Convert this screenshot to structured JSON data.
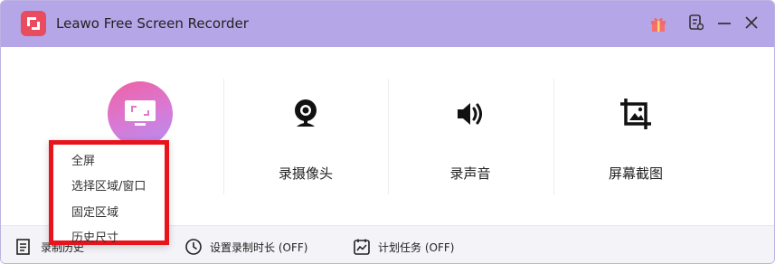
{
  "window": {
    "title": "Leawo Free Screen Recorder"
  },
  "modes": [
    {
      "label": "",
      "icon": "monitor-icon",
      "active": true
    },
    {
      "label": "录摄像头",
      "icon": "webcam-icon"
    },
    {
      "label": "录声音",
      "icon": "speaker-icon"
    },
    {
      "label": "屏幕截图",
      "icon": "crop-image-icon"
    }
  ],
  "dropdown": {
    "items": [
      "全屏",
      "选择区域/窗口",
      "固定区域",
      "历史尺寸"
    ]
  },
  "bottom_bar": {
    "history_label": "录制历史",
    "timer_label": "设置录制时长 (OFF)",
    "task_label": "计划任务 (OFF)"
  },
  "colors": {
    "titlebar": "#b5a6e8",
    "accent_gradient_start": "#f061a4",
    "accent_gradient_end": "#b48ef0",
    "highlight_border": "#e8141c",
    "logo": "#e94b5f"
  }
}
